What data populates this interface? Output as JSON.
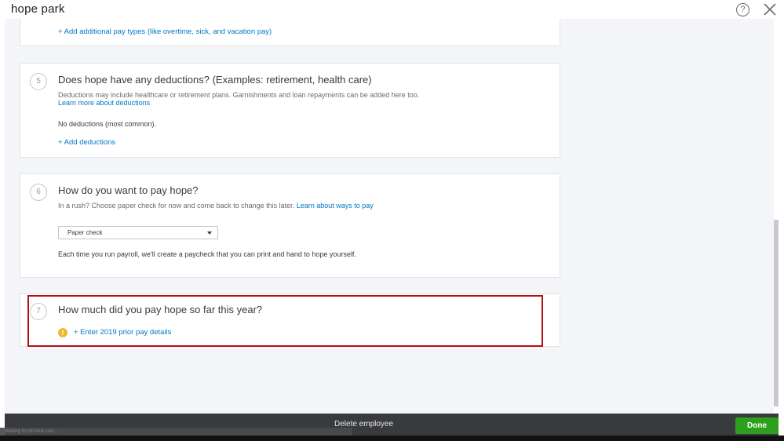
{
  "header": {
    "title": "hope park",
    "help_glyph": "?"
  },
  "section4": {
    "add_pay_types_link": "+ Add additional pay types (like overtime, sick, and vacation pay)"
  },
  "section5": {
    "step": "5",
    "question": "Does hope have any deductions? (Examples: retirement, health care)",
    "description": "Deductions may include healthcare or retirement plans. Garnishments and loan repayments can be added here too.",
    "learn_more_link": "Learn more about deductions",
    "status": "No deductions (most common).",
    "add_link": "+ Add deductions"
  },
  "section6": {
    "step": "6",
    "question": "How do you want to pay hope?",
    "hint": "In a rush? Choose paper check for now and come back to change this later.",
    "learn_link": "Learn about ways to pay",
    "payment_method_selected": "Paper check",
    "note": "Each time you run payroll, we'll create a paycheck that you can print and hand to hope yourself."
  },
  "section7": {
    "step": "7",
    "question": "How much did you pay hope so far this year?",
    "warning_glyph": "!",
    "enter_link": "+ Enter 2019 prior pay details"
  },
  "footer": {
    "delete_label": "Delete employee",
    "done_label": "Done",
    "status_text": "Waiting for pf-intuit.com..."
  },
  "colors": {
    "link": "#0077c5",
    "done_button": "#2ca01c",
    "highlight_border": "#b40e14",
    "warning": "#f0b82d",
    "footer_bg": "#393a3d"
  }
}
